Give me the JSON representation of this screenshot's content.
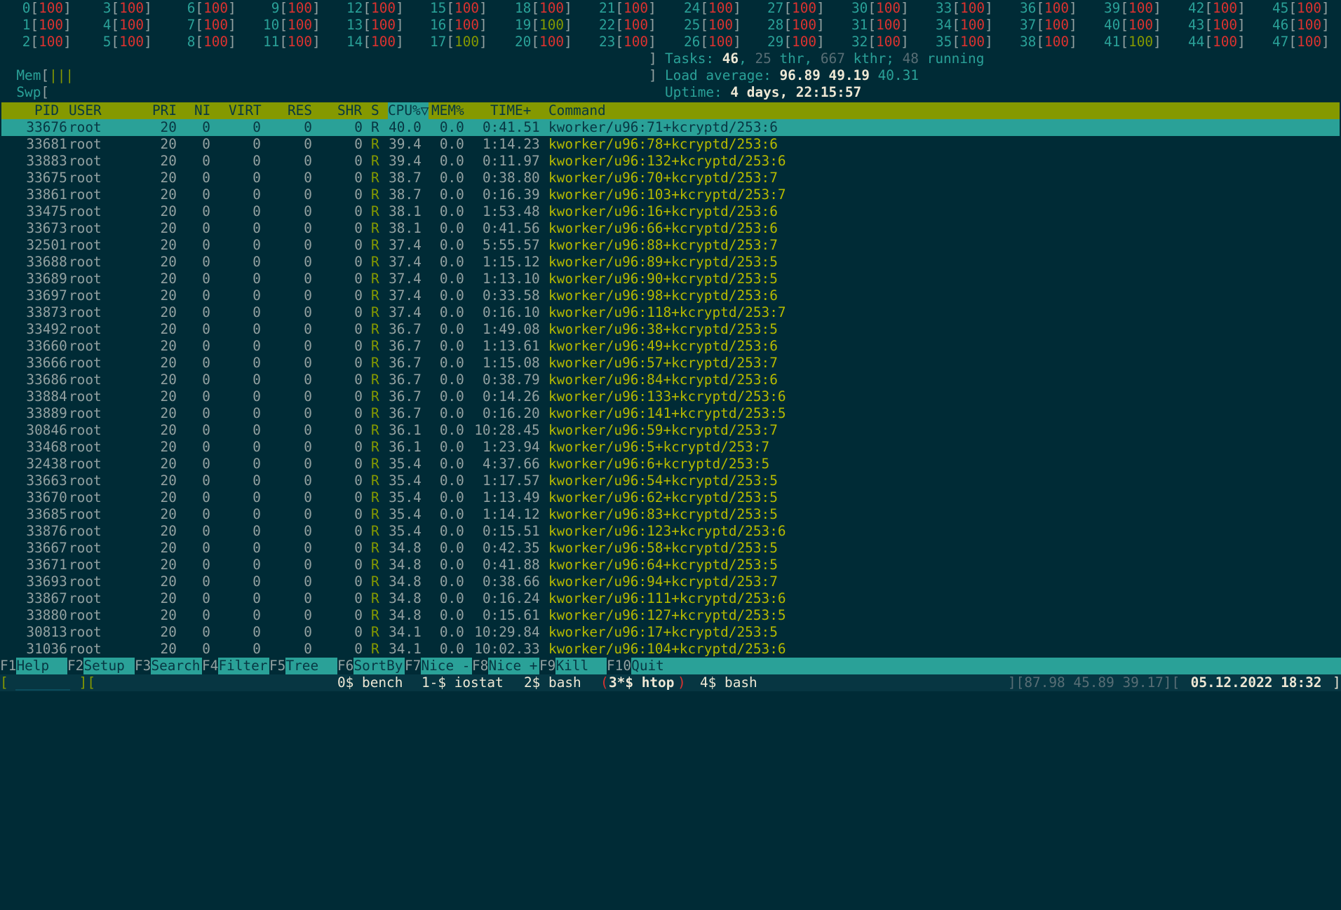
{
  "cpus": [
    {
      "id": "0",
      "val": "100"
    },
    {
      "id": "1",
      "val": "100"
    },
    {
      "id": "2",
      "val": "100"
    },
    {
      "id": "3",
      "val": "100"
    },
    {
      "id": "4",
      "val": "100"
    },
    {
      "id": "5",
      "val": "100"
    },
    {
      "id": "6",
      "val": "100"
    },
    {
      "id": "7",
      "val": "100"
    },
    {
      "id": "8",
      "val": "100"
    },
    {
      "id": "9",
      "val": "100"
    },
    {
      "id": "10",
      "val": "100"
    },
    {
      "id": "11",
      "val": "100"
    },
    {
      "id": "12",
      "val": "100"
    },
    {
      "id": "13",
      "val": "100"
    },
    {
      "id": "14",
      "val": "100"
    },
    {
      "id": "15",
      "val": "100"
    },
    {
      "id": "16",
      "val": "100"
    },
    {
      "id": "17",
      "val": "100"
    },
    {
      "id": "18",
      "val": "100"
    },
    {
      "id": "19",
      "val": "100"
    },
    {
      "id": "20",
      "val": "100"
    },
    {
      "id": "21",
      "val": "100"
    },
    {
      "id": "22",
      "val": "100"
    },
    {
      "id": "23",
      "val": "100"
    },
    {
      "id": "24",
      "val": "100"
    },
    {
      "id": "25",
      "val": "100"
    },
    {
      "id": "26",
      "val": "100"
    },
    {
      "id": "27",
      "val": "100"
    },
    {
      "id": "28",
      "val": "100"
    },
    {
      "id": "29",
      "val": "100"
    },
    {
      "id": "30",
      "val": "100"
    },
    {
      "id": "31",
      "val": "100"
    },
    {
      "id": "32",
      "val": "100"
    },
    {
      "id": "33",
      "val": "100"
    },
    {
      "id": "34",
      "val": "100"
    },
    {
      "id": "35",
      "val": "100"
    },
    {
      "id": "36",
      "val": "100"
    },
    {
      "id": "37",
      "val": "100"
    },
    {
      "id": "38",
      "val": "100"
    },
    {
      "id": "39",
      "val": "100"
    },
    {
      "id": "40",
      "val": "100"
    },
    {
      "id": "41",
      "val": "100"
    },
    {
      "id": "42",
      "val": "100"
    },
    {
      "id": "43",
      "val": "100"
    },
    {
      "id": "44",
      "val": "100"
    },
    {
      "id": "45",
      "val": "100"
    },
    {
      "id": "46",
      "val": "100"
    },
    {
      "id": "47",
      "val": "100"
    }
  ],
  "green_cpus": [
    "17",
    "19",
    "41"
  ],
  "meters": {
    "mem_label": "Mem",
    "mem_bar": "|||",
    "swp_label": "Swp"
  },
  "stats": {
    "tasks_label": "Tasks: ",
    "tasks": "46",
    "thr": "25",
    "thr_label": " thr, ",
    "kthr": "667",
    "kthr_label": " kthr; ",
    "running": "48",
    "running_label": " running",
    "load_label": "Load average: ",
    "load1": "96.89",
    "load5": "49.19",
    "load15": "40.31",
    "uptime_label": "Uptime: ",
    "uptime": "4 days, 22:15:57"
  },
  "columns": {
    "pid": "PID",
    "user": "USER",
    "pri": "PRI",
    "ni": "NI",
    "virt": "VIRT",
    "res": "RES",
    "shr": "SHR",
    "s": "S",
    "cpu": "CPU%▽",
    "mem": "MEM%",
    "time": "TIME+",
    "command": "Command"
  },
  "processes": [
    {
      "pid": "33676",
      "user": "root",
      "pri": "20",
      "ni": "0",
      "virt": "0",
      "res": "0",
      "shr": "0",
      "s": "R",
      "cpu": "40.0",
      "mem": "0.0",
      "time": "0:41.51",
      "cmd": "kworker/u96:71+kcryptd/253:6"
    },
    {
      "pid": "33681",
      "user": "root",
      "pri": "20",
      "ni": "0",
      "virt": "0",
      "res": "0",
      "shr": "0",
      "s": "R",
      "cpu": "39.4",
      "mem": "0.0",
      "time": "1:14.23",
      "cmd": "kworker/u96:78+kcryptd/253:6"
    },
    {
      "pid": "33883",
      "user": "root",
      "pri": "20",
      "ni": "0",
      "virt": "0",
      "res": "0",
      "shr": "0",
      "s": "R",
      "cpu": "39.4",
      "mem": "0.0",
      "time": "0:11.97",
      "cmd": "kworker/u96:132+kcryptd/253:6"
    },
    {
      "pid": "33675",
      "user": "root",
      "pri": "20",
      "ni": "0",
      "virt": "0",
      "res": "0",
      "shr": "0",
      "s": "R",
      "cpu": "38.7",
      "mem": "0.0",
      "time": "0:38.80",
      "cmd": "kworker/u96:70+kcryptd/253:7"
    },
    {
      "pid": "33861",
      "user": "root",
      "pri": "20",
      "ni": "0",
      "virt": "0",
      "res": "0",
      "shr": "0",
      "s": "R",
      "cpu": "38.7",
      "mem": "0.0",
      "time": "0:16.39",
      "cmd": "kworker/u96:103+kcryptd/253:7"
    },
    {
      "pid": "33475",
      "user": "root",
      "pri": "20",
      "ni": "0",
      "virt": "0",
      "res": "0",
      "shr": "0",
      "s": "R",
      "cpu": "38.1",
      "mem": "0.0",
      "time": "1:53.48",
      "cmd": "kworker/u96:16+kcryptd/253:6"
    },
    {
      "pid": "33673",
      "user": "root",
      "pri": "20",
      "ni": "0",
      "virt": "0",
      "res": "0",
      "shr": "0",
      "s": "R",
      "cpu": "38.1",
      "mem": "0.0",
      "time": "0:41.56",
      "cmd": "kworker/u96:66+kcryptd/253:6"
    },
    {
      "pid": "32501",
      "user": "root",
      "pri": "20",
      "ni": "0",
      "virt": "0",
      "res": "0",
      "shr": "0",
      "s": "R",
      "cpu": "37.4",
      "mem": "0.0",
      "time": "5:55.57",
      "cmd": "kworker/u96:88+kcryptd/253:7"
    },
    {
      "pid": "33688",
      "user": "root",
      "pri": "20",
      "ni": "0",
      "virt": "0",
      "res": "0",
      "shr": "0",
      "s": "R",
      "cpu": "37.4",
      "mem": "0.0",
      "time": "1:15.12",
      "cmd": "kworker/u96:89+kcryptd/253:5"
    },
    {
      "pid": "33689",
      "user": "root",
      "pri": "20",
      "ni": "0",
      "virt": "0",
      "res": "0",
      "shr": "0",
      "s": "R",
      "cpu": "37.4",
      "mem": "0.0",
      "time": "1:13.10",
      "cmd": "kworker/u96:90+kcryptd/253:5"
    },
    {
      "pid": "33697",
      "user": "root",
      "pri": "20",
      "ni": "0",
      "virt": "0",
      "res": "0",
      "shr": "0",
      "s": "R",
      "cpu": "37.4",
      "mem": "0.0",
      "time": "0:33.58",
      "cmd": "kworker/u96:98+kcryptd/253:6"
    },
    {
      "pid": "33873",
      "user": "root",
      "pri": "20",
      "ni": "0",
      "virt": "0",
      "res": "0",
      "shr": "0",
      "s": "R",
      "cpu": "37.4",
      "mem": "0.0",
      "time": "0:16.10",
      "cmd": "kworker/u96:118+kcryptd/253:7"
    },
    {
      "pid": "33492",
      "user": "root",
      "pri": "20",
      "ni": "0",
      "virt": "0",
      "res": "0",
      "shr": "0",
      "s": "R",
      "cpu": "36.7",
      "mem": "0.0",
      "time": "1:49.08",
      "cmd": "kworker/u96:38+kcryptd/253:5"
    },
    {
      "pid": "33660",
      "user": "root",
      "pri": "20",
      "ni": "0",
      "virt": "0",
      "res": "0",
      "shr": "0",
      "s": "R",
      "cpu": "36.7",
      "mem": "0.0",
      "time": "1:13.61",
      "cmd": "kworker/u96:49+kcryptd/253:6"
    },
    {
      "pid": "33666",
      "user": "root",
      "pri": "20",
      "ni": "0",
      "virt": "0",
      "res": "0",
      "shr": "0",
      "s": "R",
      "cpu": "36.7",
      "mem": "0.0",
      "time": "1:15.08",
      "cmd": "kworker/u96:57+kcryptd/253:7"
    },
    {
      "pid": "33686",
      "user": "root",
      "pri": "20",
      "ni": "0",
      "virt": "0",
      "res": "0",
      "shr": "0",
      "s": "R",
      "cpu": "36.7",
      "mem": "0.0",
      "time": "0:38.79",
      "cmd": "kworker/u96:84+kcryptd/253:6"
    },
    {
      "pid": "33884",
      "user": "root",
      "pri": "20",
      "ni": "0",
      "virt": "0",
      "res": "0",
      "shr": "0",
      "s": "R",
      "cpu": "36.7",
      "mem": "0.0",
      "time": "0:14.26",
      "cmd": "kworker/u96:133+kcryptd/253:6"
    },
    {
      "pid": "33889",
      "user": "root",
      "pri": "20",
      "ni": "0",
      "virt": "0",
      "res": "0",
      "shr": "0",
      "s": "R",
      "cpu": "36.7",
      "mem": "0.0",
      "time": "0:16.20",
      "cmd": "kworker/u96:141+kcryptd/253:5"
    },
    {
      "pid": "30846",
      "user": "root",
      "pri": "20",
      "ni": "0",
      "virt": "0",
      "res": "0",
      "shr": "0",
      "s": "R",
      "cpu": "36.1",
      "mem": "0.0",
      "time": "10:28.45",
      "cmd": "kworker/u96:59+kcryptd/253:7"
    },
    {
      "pid": "33468",
      "user": "root",
      "pri": "20",
      "ni": "0",
      "virt": "0",
      "res": "0",
      "shr": "0",
      "s": "R",
      "cpu": "36.1",
      "mem": "0.0",
      "time": "1:23.94",
      "cmd": "kworker/u96:5+kcryptd/253:7"
    },
    {
      "pid": "32438",
      "user": "root",
      "pri": "20",
      "ni": "0",
      "virt": "0",
      "res": "0",
      "shr": "0",
      "s": "R",
      "cpu": "35.4",
      "mem": "0.0",
      "time": "4:37.66",
      "cmd": "kworker/u96:6+kcryptd/253:5"
    },
    {
      "pid": "33663",
      "user": "root",
      "pri": "20",
      "ni": "0",
      "virt": "0",
      "res": "0",
      "shr": "0",
      "s": "R",
      "cpu": "35.4",
      "mem": "0.0",
      "time": "1:17.57",
      "cmd": "kworker/u96:54+kcryptd/253:5"
    },
    {
      "pid": "33670",
      "user": "root",
      "pri": "20",
      "ni": "0",
      "virt": "0",
      "res": "0",
      "shr": "0",
      "s": "R",
      "cpu": "35.4",
      "mem": "0.0",
      "time": "1:13.49",
      "cmd": "kworker/u96:62+kcryptd/253:5"
    },
    {
      "pid": "33685",
      "user": "root",
      "pri": "20",
      "ni": "0",
      "virt": "0",
      "res": "0",
      "shr": "0",
      "s": "R",
      "cpu": "35.4",
      "mem": "0.0",
      "time": "1:14.12",
      "cmd": "kworker/u96:83+kcryptd/253:5"
    },
    {
      "pid": "33876",
      "user": "root",
      "pri": "20",
      "ni": "0",
      "virt": "0",
      "res": "0",
      "shr": "0",
      "s": "R",
      "cpu": "35.4",
      "mem": "0.0",
      "time": "0:15.51",
      "cmd": "kworker/u96:123+kcryptd/253:6"
    },
    {
      "pid": "33667",
      "user": "root",
      "pri": "20",
      "ni": "0",
      "virt": "0",
      "res": "0",
      "shr": "0",
      "s": "R",
      "cpu": "34.8",
      "mem": "0.0",
      "time": "0:42.35",
      "cmd": "kworker/u96:58+kcryptd/253:5"
    },
    {
      "pid": "33671",
      "user": "root",
      "pri": "20",
      "ni": "0",
      "virt": "0",
      "res": "0",
      "shr": "0",
      "s": "R",
      "cpu": "34.8",
      "mem": "0.0",
      "time": "0:41.88",
      "cmd": "kworker/u96:64+kcryptd/253:5"
    },
    {
      "pid": "33693",
      "user": "root",
      "pri": "20",
      "ni": "0",
      "virt": "0",
      "res": "0",
      "shr": "0",
      "s": "R",
      "cpu": "34.8",
      "mem": "0.0",
      "time": "0:38.66",
      "cmd": "kworker/u96:94+kcryptd/253:7"
    },
    {
      "pid": "33867",
      "user": "root",
      "pri": "20",
      "ni": "0",
      "virt": "0",
      "res": "0",
      "shr": "0",
      "s": "R",
      "cpu": "34.8",
      "mem": "0.0",
      "time": "0:16.24",
      "cmd": "kworker/u96:111+kcryptd/253:6"
    },
    {
      "pid": "33880",
      "user": "root",
      "pri": "20",
      "ni": "0",
      "virt": "0",
      "res": "0",
      "shr": "0",
      "s": "R",
      "cpu": "34.8",
      "mem": "0.0",
      "time": "0:15.61",
      "cmd": "kworker/u96:127+kcryptd/253:5"
    },
    {
      "pid": "30813",
      "user": "root",
      "pri": "20",
      "ni": "0",
      "virt": "0",
      "res": "0",
      "shr": "0",
      "s": "R",
      "cpu": "34.1",
      "mem": "0.0",
      "time": "10:29.84",
      "cmd": "kworker/u96:17+kcryptd/253:5"
    },
    {
      "pid": "31036",
      "user": "root",
      "pri": "20",
      "ni": "0",
      "virt": "0",
      "res": "0",
      "shr": "0",
      "s": "R",
      "cpu": "34.1",
      "mem": "0.0",
      "time": "10:02.33",
      "cmd": "kworker/u96:104+kcryptd/253:6"
    }
  ],
  "fkeys": [
    {
      "key": "F1",
      "label": "Help  "
    },
    {
      "key": "F2",
      "label": "Setup "
    },
    {
      "key": "F3",
      "label": "Search"
    },
    {
      "key": "F4",
      "label": "Filter"
    },
    {
      "key": "F5",
      "label": "Tree  "
    },
    {
      "key": "F6",
      "label": "SortBy"
    },
    {
      "key": "F7",
      "label": "Nice -"
    },
    {
      "key": "F8",
      "label": "Nice +"
    },
    {
      "key": "F9",
      "label": "Kill  "
    },
    {
      "key": "F10",
      "label": "Quit"
    }
  ],
  "tmux": {
    "left": "[ ",
    "left2": " ][",
    "windows": [
      {
        "label": "0$ bench",
        "active": false
      },
      {
        "label": "1-$ iostat",
        "active": false
      },
      {
        "label": "2$ bash",
        "active": false
      },
      {
        "label": "3*$ htop",
        "active": true
      },
      {
        "label": "4$ bash",
        "active": false
      }
    ],
    "load": "][87.98 45.89 39.17][",
    "datetime": " 05.12.2022 18:32 ",
    "close": "]"
  },
  "colors": {
    "background": "#002b36",
    "header_bg": "#859900",
    "selection_bg": "#2aa198",
    "cpu_value": "#dc322f",
    "command": "#b5b900"
  }
}
